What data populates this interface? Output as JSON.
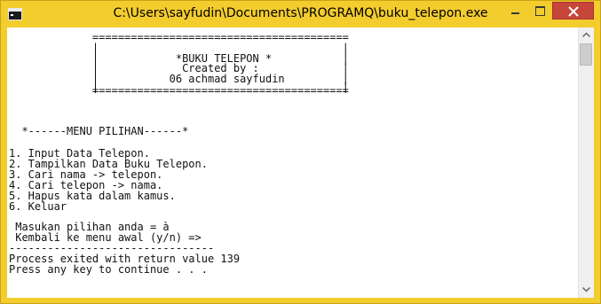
{
  "window": {
    "title": "C:\\Users\\sayfudin\\Documents\\PROGRAMQ\\buku_telepon.exe"
  },
  "colors": {
    "frame": "#f3cc2e",
    "close_button": "#c7463a",
    "console_background": "#ffffff",
    "console_text": "#111111"
  },
  "icons": {
    "app": "console-app-icon",
    "minimize": "minimize-icon",
    "maximize": "maximize-icon",
    "close": "close-icon",
    "scroll_up": "chevron-up-icon",
    "scroll_down": "chevron-down-icon"
  },
  "console": {
    "header_border_top": "             ========================================",
    "header_side_1": "             |                                      |",
    "header_title": "             |            *BUKU TELEPON *           |",
    "header_created": "             |             Created by :             |",
    "header_author": "             |           06 achmad sayfudin         |",
    "header_side_2": "             |                                      |",
    "header_border_bottom": "             ========================================",
    "menu_title": "  *------MENU PILIHAN------*",
    "menu_items": [
      "1. Input Data Telepon.",
      "2. Tampilkan Data Buku Telepon.",
      "3. Cari nama -> telepon.",
      "4. Cari telepon -> nama.",
      "5. Hapus kata dalam kamus.",
      "6. Keluar"
    ],
    "prompt_choice": " Masukan pilihan anda = à",
    "prompt_back": " Kembali ke menu awal (y/n) =>",
    "separator": "--------------------------------",
    "exit_message": "Process exited with return value 139",
    "continue_message": "Press any key to continue . . ."
  }
}
